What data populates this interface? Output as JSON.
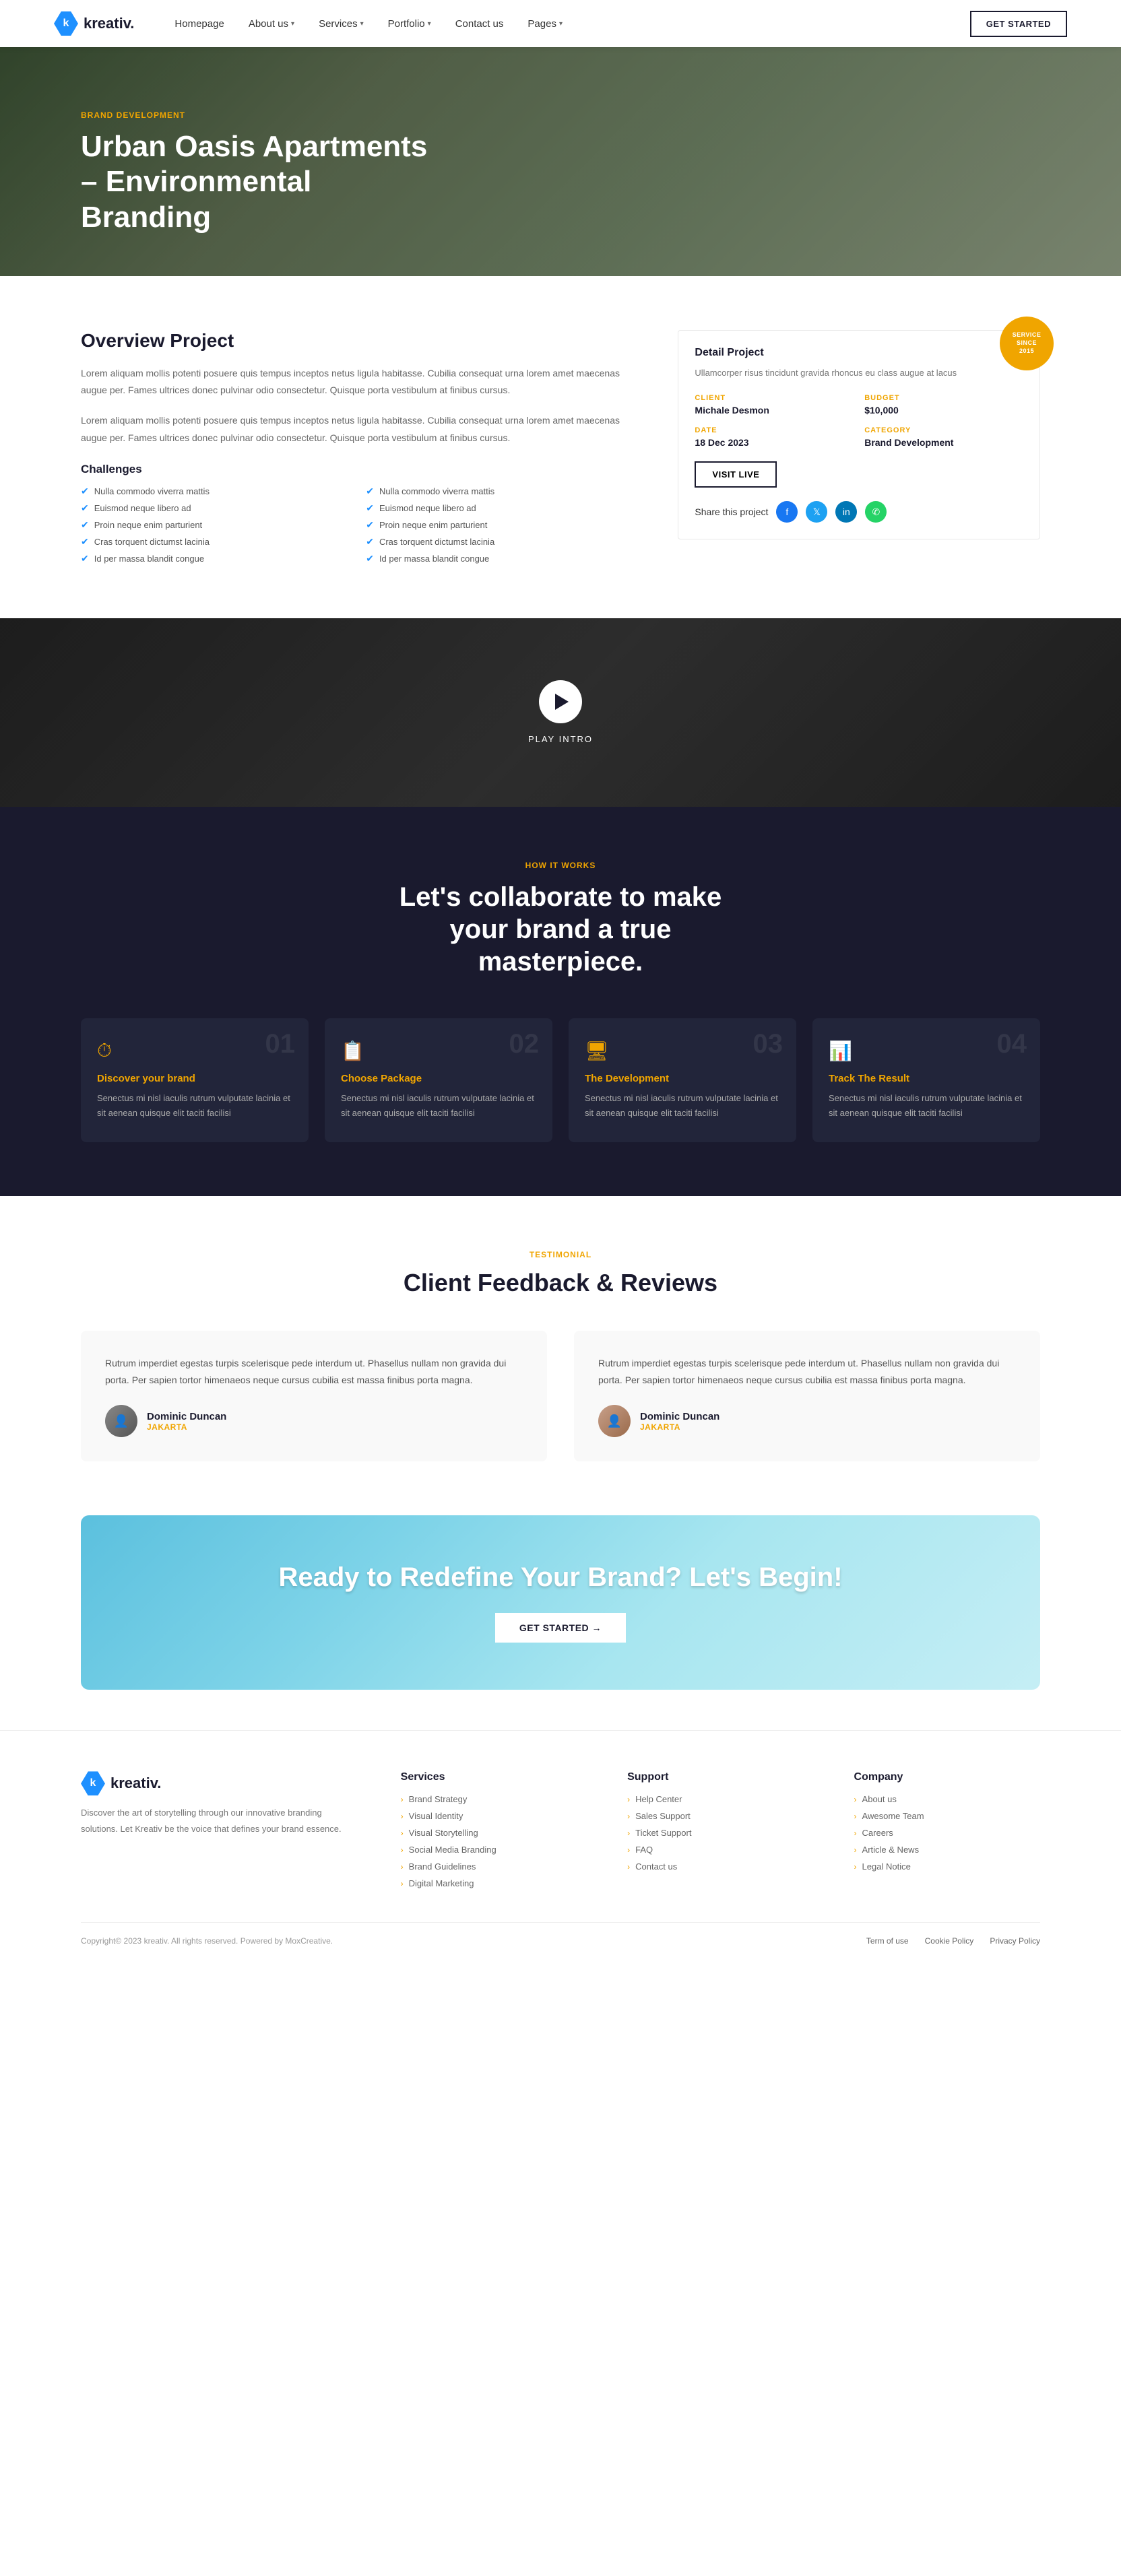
{
  "nav": {
    "logo_text": "kreativ.",
    "links": [
      {
        "label": "Homepage",
        "has_dropdown": false
      },
      {
        "label": "About us",
        "has_dropdown": true
      },
      {
        "label": "Services",
        "has_dropdown": true
      },
      {
        "label": "Portfolio",
        "has_dropdown": true
      },
      {
        "label": "Contact us",
        "has_dropdown": false
      },
      {
        "label": "Pages",
        "has_dropdown": true
      }
    ],
    "cta_label": "GET STARTED"
  },
  "hero": {
    "tag": "BRAND DEVELOPMENT",
    "title": "Urban Oasis Apartments – Environmental Branding"
  },
  "overview": {
    "title": "Overview Project",
    "text1": "Lorem aliquam mollis potenti posuere quis tempus inceptos netus ligula habitasse. Cubilia consequat urna lorem amet maecenas augue per. Fames ultrices donec pulvinar odio consectetur. Quisque porta vestibulum at finibus cursus.",
    "text2": "Lorem aliquam mollis potenti posuere quis tempus inceptos netus ligula habitasse. Cubilia consequat urna lorem amet maecenas augue per. Fames ultrices donec pulvinar odio consectetur. Quisque porta vestibulum at finibus cursus.",
    "challenges_title": "Challenges",
    "challenges": [
      "Nulla commodo viverra mattis",
      "Nulla commodo viverra mattis",
      "Euismod neque libero ad",
      "Euismod neque libero ad",
      "Proin neque enim parturient",
      "Proin neque enim parturient",
      "Cras torquent dictumst lacinia",
      "Cras torquent dictumst lacinia",
      "Id per massa blandit congue",
      "Id per massa blandit congue"
    ]
  },
  "detail": {
    "title": "Detail Project",
    "desc": "Ullamcorper risus tincidunt gravida rhoncus eu class augue at lacus",
    "client_label": "CLIENT",
    "client_value": "Michale Desmon",
    "budget_label": "BUDGET",
    "budget_value": "$10,000",
    "date_label": "DATE",
    "date_value": "18 Dec 2023",
    "category_label": "CATEGORY",
    "category_value": "Brand Development",
    "visit_live_label": "VISIT LIVE",
    "share_label": "Share this project",
    "badge_text": "SERVICE\nSINCE\n2015"
  },
  "video": {
    "play_label": "PLAY INTRO"
  },
  "how_it_works": {
    "tag": "HOW IT WORKS",
    "title": "Let's collaborate to make your brand a true masterpiece.",
    "steps": [
      {
        "number": "01",
        "icon": "⏱",
        "title": "Discover your brand",
        "text": "Senectus mi nisl iaculis rutrum vulputate lacinia et sit aenean quisque elit taciti facilisi"
      },
      {
        "number": "02",
        "icon": "📋",
        "title": "Choose Package",
        "text": "Senectus mi nisl iaculis rutrum vulputate lacinia et sit aenean quisque elit taciti facilisi"
      },
      {
        "number": "03",
        "icon": "🖥",
        "title": "The Development",
        "text": "Senectus mi nisl iaculis rutrum vulputate lacinia et sit aenean quisque elit taciti facilisi"
      },
      {
        "number": "04",
        "icon": "📊",
        "title": "Track The Result",
        "text": "Senectus mi nisl iaculis rutrum vulputate lacinia et sit aenean quisque elit taciti facilisi"
      }
    ]
  },
  "testimonial": {
    "tag": "TESTIMONIAL",
    "title": "Client Feedback & Reviews",
    "cards": [
      {
        "text": "Rutrum imperdiet egestas turpis scelerisque pede interdum ut. Phasellus nullam non gravida dui porta. Per sapien tortor himenaeos neque cursus cubilia est massa finibus porta magna.",
        "author": "Dominic Duncan",
        "location": "JAKARTA"
      },
      {
        "text": "Rutrum imperdiet egestas turpis scelerisque pede interdum ut. Phasellus nullam non gravida dui porta. Per sapien tortor himenaeos neque cursus cubilia est massa finibus porta magna.",
        "author": "Dominic Duncan",
        "location": "JAKARTA"
      }
    ]
  },
  "cta": {
    "title": "Ready to Redefine Your Brand? Let's Begin!",
    "btn_label": "GET STARTED →"
  },
  "footer": {
    "logo_text": "kreativ.",
    "brand_desc": "Discover the art of storytelling through our innovative branding solutions. Let Kreativ be the voice that defines your brand essence.",
    "services_title": "Services",
    "services": [
      "Brand Strategy",
      "Visual Identity",
      "Visual Storytelling",
      "Social Media Branding",
      "Brand Guidelines",
      "Digital Marketing"
    ],
    "support_title": "Support",
    "support_links": [
      "Help Center",
      "Sales Support",
      "Ticket Support",
      "FAQ",
      "Contact us"
    ],
    "company_title": "Company",
    "company_links": [
      "About us",
      "Awesome Team",
      "Careers",
      "Article & News",
      "Legal Notice"
    ],
    "copyright": "Copyright© 2023 kreativ. All rights reserved. Powered by MoxCreative.",
    "bottom_links": [
      "Term of use",
      "Cookie Policy",
      "Privacy Policy"
    ]
  }
}
